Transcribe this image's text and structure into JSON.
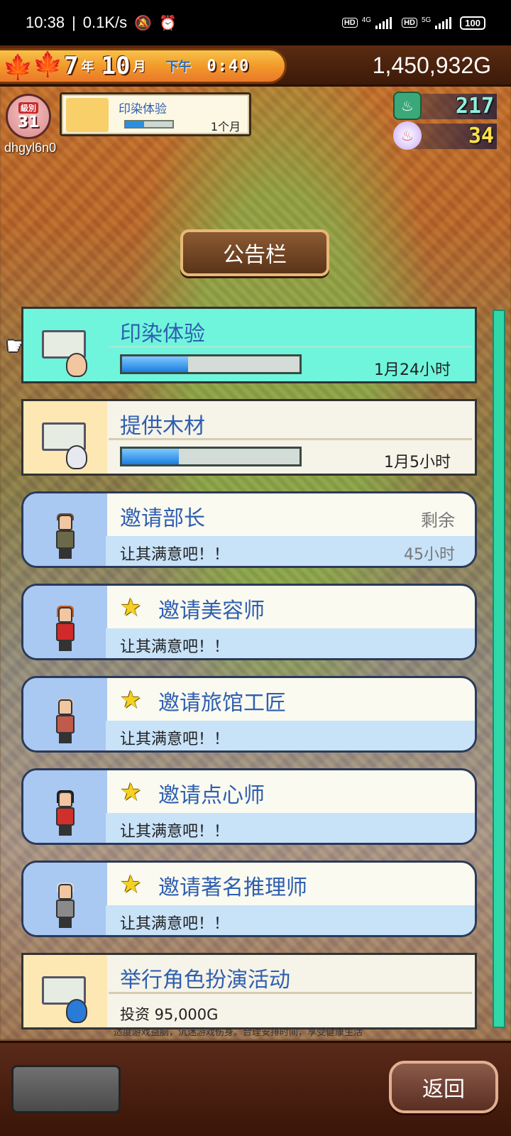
{
  "status_bar": {
    "time": "10:38",
    "net_speed": "0.1K/s",
    "sim1_label": "HD",
    "sim1_tech": "4G",
    "sim2_label": "HD",
    "sim2_tech": "5G",
    "battery": "100"
  },
  "header": {
    "year": "7",
    "year_unit": "年",
    "month": "10",
    "month_unit": "月",
    "period": "下午",
    "clock": "0:40",
    "money": "1,450,932G"
  },
  "player": {
    "level_label": "級別",
    "level": "31",
    "username": "dhgyl6n0"
  },
  "current_job": {
    "title": "印染体验",
    "progress": 0.4,
    "duration": "1个月"
  },
  "currencies": {
    "tickets": "217",
    "onsen": "34"
  },
  "board": {
    "title": "公告栏",
    "items": [
      {
        "name": "印染体验",
        "time": "1月24小时",
        "progress": 0.37
      },
      {
        "name": "提供木材",
        "time": "1月5小时",
        "progress": 0.32
      },
      {
        "name": "邀请部长",
        "remaining_label": "剩余",
        "sub": "让其满意吧！！",
        "hours": "45小时"
      },
      {
        "name": "邀请美容师",
        "sub": "让其满意吧！！"
      },
      {
        "name": "邀请旅馆工匠",
        "sub": "让其满意吧！！"
      },
      {
        "name": "邀请点心师",
        "sub": "让其满意吧！！"
      },
      {
        "name": "邀请著名推理师",
        "sub": "让其满意吧！！"
      },
      {
        "name": "举行角色扮演活动",
        "invest": "投资 95,000G"
      }
    ]
  },
  "notice": "适度游戏益脑，沉迷游戏伤身。合理安排时间，享受健康生活",
  "buttons": {
    "back": "返回"
  }
}
